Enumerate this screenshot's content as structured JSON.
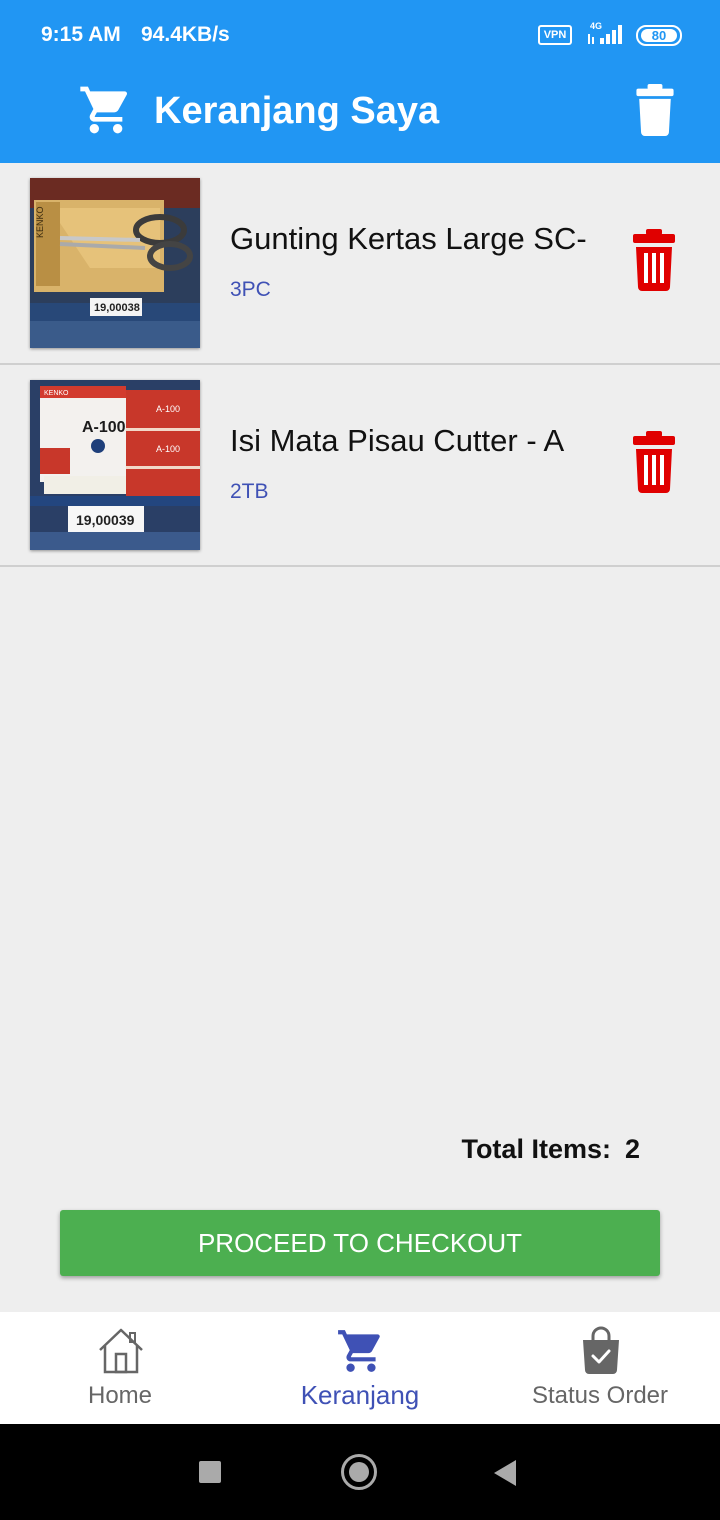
{
  "status_bar": {
    "time": "9:15 AM",
    "speed": "94.4KB/s",
    "vpn": "VPN",
    "network": "4G",
    "battery": "80"
  },
  "app_bar": {
    "title": "Keranjang Saya"
  },
  "cart": {
    "items": [
      {
        "name": "Gunting Kertas Large SC-",
        "unit": "3PC",
        "label_code": "19,00038",
        "brand": "KENKO"
      },
      {
        "name": "Isi Mata Pisau Cutter - A",
        "unit": "2TB",
        "label_code": "19,00039",
        "model": "A-100",
        "brand": "KENKO"
      }
    ]
  },
  "total": {
    "label": "Total Items:",
    "value": "2"
  },
  "checkout": {
    "label": "PROCEED TO CHECKOUT"
  },
  "bottom_nav": [
    {
      "label": "Home"
    },
    {
      "label": "Keranjang"
    },
    {
      "label": "Status Order"
    }
  ],
  "colors": {
    "primary": "#2196f3",
    "accent": "#3f51b5",
    "delete": "#e00000",
    "checkout": "#4caf50"
  }
}
